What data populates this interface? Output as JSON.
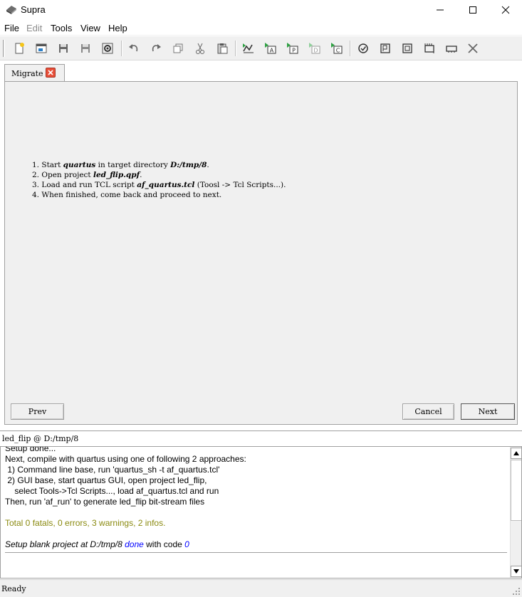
{
  "window": {
    "title": "Supra",
    "app_icon": "supra-logo-icon",
    "controls": [
      "minimize-icon",
      "maximize-icon",
      "close-icon"
    ]
  },
  "menu": {
    "items": [
      {
        "label": "File",
        "enabled": true
      },
      {
        "label": "Edit",
        "enabled": false
      },
      {
        "label": "Tools",
        "enabled": true
      },
      {
        "label": "View",
        "enabled": true
      },
      {
        "label": "Help",
        "enabled": true
      }
    ]
  },
  "toolbar": {
    "icons": [
      "new-file-icon",
      "open-icon",
      "save-icon",
      "save-as-icon",
      "settings-icon",
      "undo-icon",
      "redo-icon",
      "copy-icon",
      "cut-icon",
      "paste-icon",
      "migrate-icon",
      "run-a-icon",
      "run-p-icon",
      "run-d-icon",
      "run-c-icon",
      "check-icon",
      "program-icon",
      "board-icon",
      "chip-icon",
      "device-icon",
      "close-x-icon"
    ]
  },
  "tab": {
    "label": "Migrate"
  },
  "steps": {
    "s1": {
      "num": "1.",
      "pre": "Start ",
      "b1": "quartus",
      "mid": " in target directory ",
      "b2": "D:/tmp/8",
      "post": "."
    },
    "s2": {
      "num": "2.",
      "pre": "Open project ",
      "b1": "led_flip.qpf",
      "post": "."
    },
    "s3": {
      "num": "3.",
      "pre": "Load and run TCL script ",
      "b1": "af_quartus.tcl",
      "post": " (Toosl -> Tcl Scripts...)."
    },
    "s4": {
      "num": "4.",
      "text": "When finished, come back and proceed to next."
    }
  },
  "buttons": {
    "prev": "Prev",
    "cancel": "Cancel",
    "next": "Next"
  },
  "project": {
    "label": "led_flip @ D:/tmp/8"
  },
  "log": {
    "l0": "Setup done...",
    "l1": "Next, compile with quartus using one of following 2 approaches:",
    "l2": " 1) Command line base, run 'quartus_sh -t af_quartus.tcl'",
    "l3": " 2) GUI base, start quartus GUI, open project led_flip,",
    "l4": "    select Tools->Tcl Scripts..., load af_quartus.tcl and run",
    "l5": "Then, run 'af_run' to generate led_flip bit-stream files",
    "totals": "Total 0 fatals, 0 errors, 3 warnings, 2 infos.",
    "summary": {
      "pre": "Setup blank project at D:/tmp/8 ",
      "done": "done",
      "mid": " with code ",
      "code": "0"
    }
  },
  "status": {
    "text": "Ready"
  },
  "colors": {
    "panel_bg": "#f0f0f0",
    "warning_text": "#8a8a10",
    "highlight_blue": "#0000ff",
    "tab_close": "#e8503a"
  }
}
